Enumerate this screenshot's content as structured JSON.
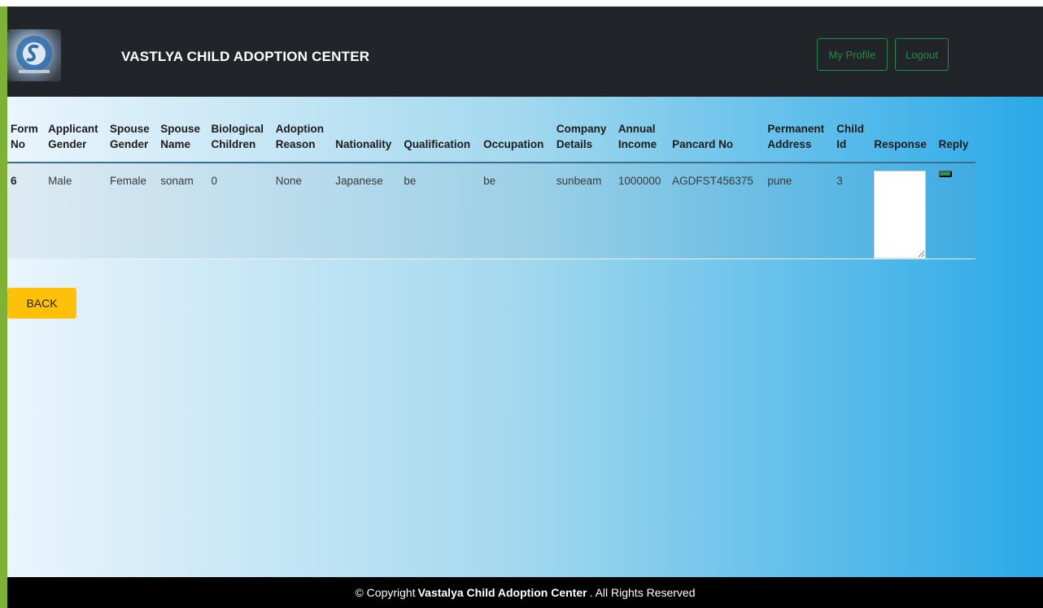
{
  "header": {
    "brand": "VASTLYA CHILD ADOPTION CENTER",
    "my_profile": "My Profile",
    "logout": "Logout"
  },
  "table": {
    "columns": [
      [
        "Form",
        "No"
      ],
      [
        "Applicant",
        "Gender"
      ],
      [
        "Spouse",
        "Gender"
      ],
      [
        "Spouse",
        "Name"
      ],
      [
        "Biological",
        "Children"
      ],
      [
        "Adoption",
        "Reason"
      ],
      [
        "",
        "Nationality"
      ],
      [
        "",
        "Qualification"
      ],
      [
        "",
        "Occupation"
      ],
      [
        "Company",
        "Details"
      ],
      [
        "Annual",
        "Income"
      ],
      [
        "",
        "Pancard No"
      ],
      [
        "Permanent",
        "Address"
      ],
      [
        "Child",
        "Id"
      ],
      [
        "",
        "Response"
      ],
      [
        "",
        "Reply"
      ]
    ],
    "rows": [
      {
        "form_no": "6",
        "applicant_gender": "Male",
        "spouse_gender": "Female",
        "spouse_name": "sonam",
        "biological_children": "0",
        "adoption_reason": "None",
        "nationality": "Japanese",
        "qualification": "be",
        "occupation": "be",
        "company_details": "sunbeam",
        "annual_income": "1000000",
        "pancard_no": "AGDFST456375",
        "permanent_address": "pune",
        "child_id": "3",
        "response": ""
      }
    ]
  },
  "back_button": "BACK",
  "footer": {
    "prefix": "© Copyright",
    "name": "Vastalya Child Adoption Center",
    "suffix": ". All Rights Reserved"
  },
  "colors": {
    "topbar": "#212429",
    "accent_green": "#1f8c43",
    "back_yellow": "#ffc107",
    "left_bar": "#7db234"
  }
}
